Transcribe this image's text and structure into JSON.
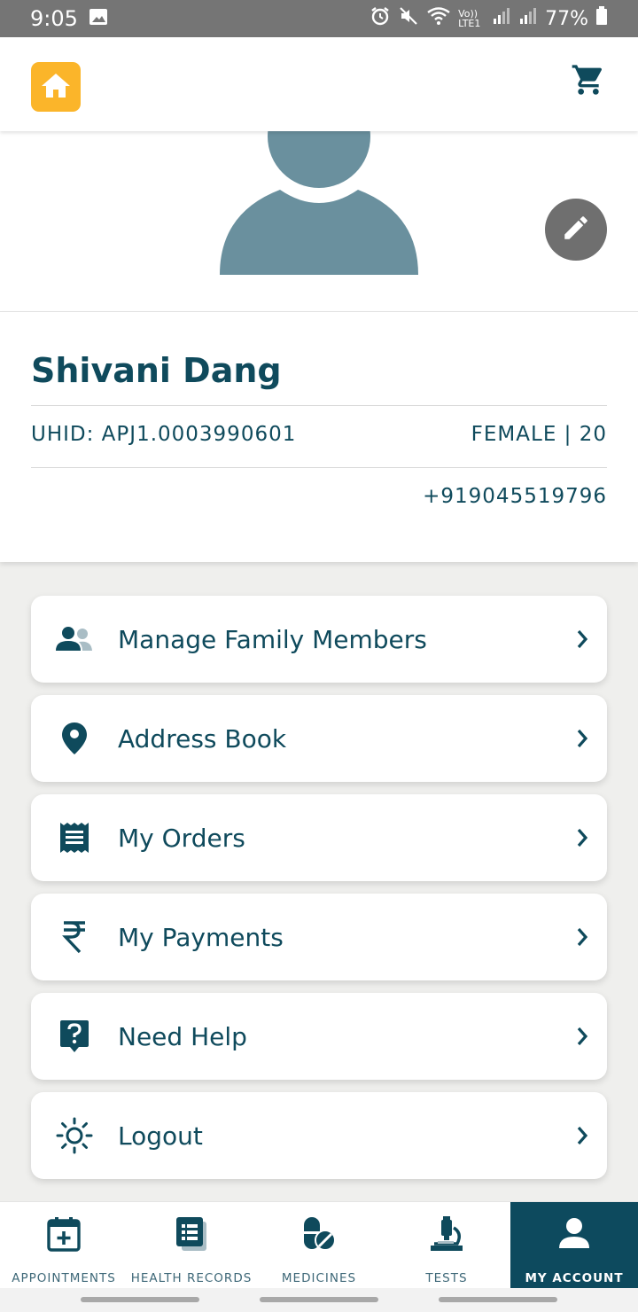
{
  "status_bar": {
    "time": "9:05",
    "network": "Vo)) LTE1",
    "battery": "77%"
  },
  "header": {
    "home_icon": "home-icon",
    "cart_icon": "cart-icon"
  },
  "profile": {
    "name": "Shivani Dang",
    "uhid": "UHID: APJ1.0003990601",
    "gender_age": "FEMALE | 20",
    "phone": "+919045519796",
    "edit_icon": "pencil-icon"
  },
  "menu": {
    "items": [
      {
        "label": "Manage Family Members",
        "icon": "family-icon"
      },
      {
        "label": "Address Book",
        "icon": "location-pin-icon"
      },
      {
        "label": "My Orders",
        "icon": "receipt-icon"
      },
      {
        "label": "My Payments",
        "icon": "rupee-icon"
      },
      {
        "label": "Need Help",
        "icon": "help-icon"
      },
      {
        "label": "Logout",
        "icon": "logout-icon"
      }
    ]
  },
  "bottom_nav": {
    "tabs": [
      {
        "label": "APPOINTMENTS",
        "icon": "calendar-plus-icon",
        "active": false
      },
      {
        "label": "HEALTH RECORDS",
        "icon": "records-icon",
        "active": false
      },
      {
        "label": "MEDICINES",
        "icon": "pill-icon",
        "active": false
      },
      {
        "label": "TESTS",
        "icon": "microscope-icon",
        "active": false
      },
      {
        "label": "MY ACCOUNT",
        "icon": "person-icon",
        "active": true
      }
    ]
  },
  "colors": {
    "primary": "#0f4a5c",
    "accent": "#fbb52a",
    "avatar": "#6a909e",
    "active_tab": "#0d4a5e"
  }
}
